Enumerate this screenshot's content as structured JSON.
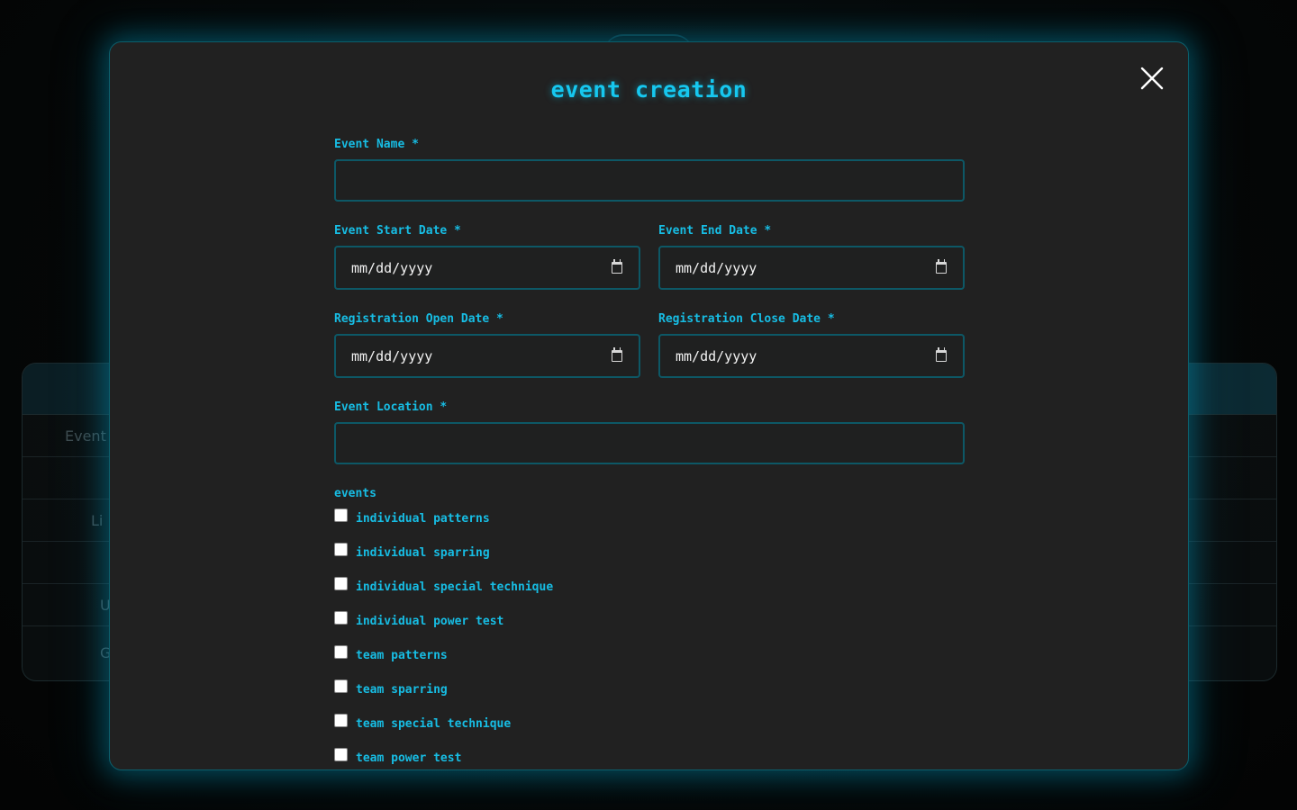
{
  "background": {
    "table_rows": [
      {
        "left": "Event",
        "right": ""
      },
      {
        "left": "",
        "right": ""
      },
      {
        "left": "Li",
        "right": ""
      },
      {
        "left": "",
        "right": ""
      },
      {
        "left": "U",
        "right": ""
      },
      {
        "left": "G",
        "right": ""
      }
    ]
  },
  "modal": {
    "title": "event creation",
    "close_icon": "close-x-icon",
    "fields": {
      "event_name": {
        "label": "Event Name *",
        "value": ""
      },
      "start_date": {
        "label": "Event Start Date *",
        "value": "mm/dd/yyyy"
      },
      "end_date": {
        "label": "Event End Date *",
        "value": "mm/dd/yyyy"
      },
      "reg_open": {
        "label": "Registration Open Date *",
        "value": "mm/dd/yyyy"
      },
      "reg_close": {
        "label": "Registration Close Date *",
        "value": "mm/dd/yyyy"
      },
      "location": {
        "label": "Event Location *",
        "value": ""
      }
    },
    "events_label": "events",
    "events": [
      {
        "label": "individual patterns",
        "checked": false
      },
      {
        "label": "individual sparring",
        "checked": false
      },
      {
        "label": "individual special technique",
        "checked": false
      },
      {
        "label": "individual power test",
        "checked": false
      },
      {
        "label": "team patterns",
        "checked": false
      },
      {
        "label": "team sparring",
        "checked": false
      },
      {
        "label": "team special technique",
        "checked": false
      },
      {
        "label": "team power test",
        "checked": false
      }
    ]
  },
  "colors": {
    "accent": "#17bde4",
    "modal_bg": "#212121",
    "field_border": "#0d5866",
    "page_bg": "#050606"
  }
}
